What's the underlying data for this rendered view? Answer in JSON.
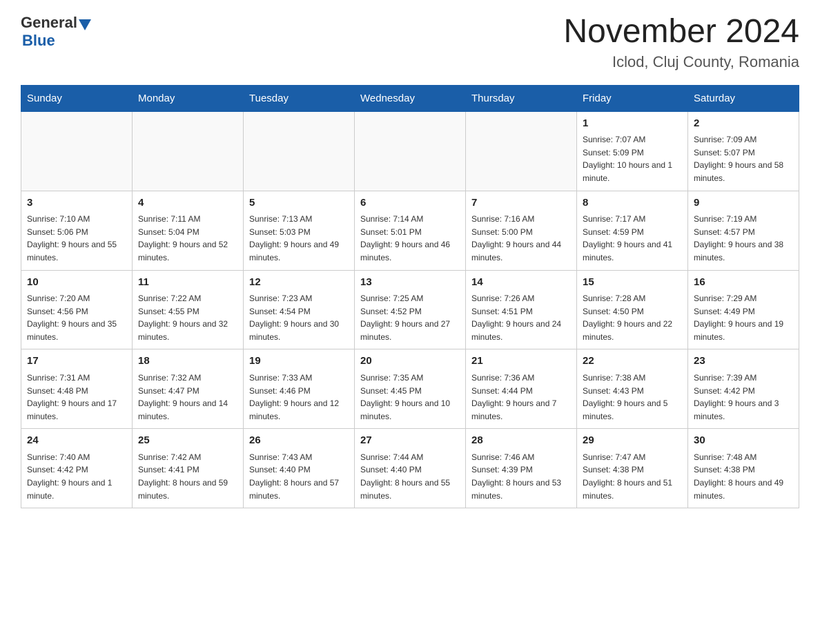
{
  "header": {
    "logo_general": "General",
    "logo_blue": "Blue",
    "month_title": "November 2024",
    "location": "Iclod, Cluj County, Romania"
  },
  "days_of_week": [
    "Sunday",
    "Monday",
    "Tuesday",
    "Wednesday",
    "Thursday",
    "Friday",
    "Saturday"
  ],
  "weeks": [
    {
      "days": [
        {
          "number": "",
          "info": ""
        },
        {
          "number": "",
          "info": ""
        },
        {
          "number": "",
          "info": ""
        },
        {
          "number": "",
          "info": ""
        },
        {
          "number": "",
          "info": ""
        },
        {
          "number": "1",
          "info": "Sunrise: 7:07 AM\nSunset: 5:09 PM\nDaylight: 10 hours and 1 minute."
        },
        {
          "number": "2",
          "info": "Sunrise: 7:09 AM\nSunset: 5:07 PM\nDaylight: 9 hours and 58 minutes."
        }
      ]
    },
    {
      "days": [
        {
          "number": "3",
          "info": "Sunrise: 7:10 AM\nSunset: 5:06 PM\nDaylight: 9 hours and 55 minutes."
        },
        {
          "number": "4",
          "info": "Sunrise: 7:11 AM\nSunset: 5:04 PM\nDaylight: 9 hours and 52 minutes."
        },
        {
          "number": "5",
          "info": "Sunrise: 7:13 AM\nSunset: 5:03 PM\nDaylight: 9 hours and 49 minutes."
        },
        {
          "number": "6",
          "info": "Sunrise: 7:14 AM\nSunset: 5:01 PM\nDaylight: 9 hours and 46 minutes."
        },
        {
          "number": "7",
          "info": "Sunrise: 7:16 AM\nSunset: 5:00 PM\nDaylight: 9 hours and 44 minutes."
        },
        {
          "number": "8",
          "info": "Sunrise: 7:17 AM\nSunset: 4:59 PM\nDaylight: 9 hours and 41 minutes."
        },
        {
          "number": "9",
          "info": "Sunrise: 7:19 AM\nSunset: 4:57 PM\nDaylight: 9 hours and 38 minutes."
        }
      ]
    },
    {
      "days": [
        {
          "number": "10",
          "info": "Sunrise: 7:20 AM\nSunset: 4:56 PM\nDaylight: 9 hours and 35 minutes."
        },
        {
          "number": "11",
          "info": "Sunrise: 7:22 AM\nSunset: 4:55 PM\nDaylight: 9 hours and 32 minutes."
        },
        {
          "number": "12",
          "info": "Sunrise: 7:23 AM\nSunset: 4:54 PM\nDaylight: 9 hours and 30 minutes."
        },
        {
          "number": "13",
          "info": "Sunrise: 7:25 AM\nSunset: 4:52 PM\nDaylight: 9 hours and 27 minutes."
        },
        {
          "number": "14",
          "info": "Sunrise: 7:26 AM\nSunset: 4:51 PM\nDaylight: 9 hours and 24 minutes."
        },
        {
          "number": "15",
          "info": "Sunrise: 7:28 AM\nSunset: 4:50 PM\nDaylight: 9 hours and 22 minutes."
        },
        {
          "number": "16",
          "info": "Sunrise: 7:29 AM\nSunset: 4:49 PM\nDaylight: 9 hours and 19 minutes."
        }
      ]
    },
    {
      "days": [
        {
          "number": "17",
          "info": "Sunrise: 7:31 AM\nSunset: 4:48 PM\nDaylight: 9 hours and 17 minutes."
        },
        {
          "number": "18",
          "info": "Sunrise: 7:32 AM\nSunset: 4:47 PM\nDaylight: 9 hours and 14 minutes."
        },
        {
          "number": "19",
          "info": "Sunrise: 7:33 AM\nSunset: 4:46 PM\nDaylight: 9 hours and 12 minutes."
        },
        {
          "number": "20",
          "info": "Sunrise: 7:35 AM\nSunset: 4:45 PM\nDaylight: 9 hours and 10 minutes."
        },
        {
          "number": "21",
          "info": "Sunrise: 7:36 AM\nSunset: 4:44 PM\nDaylight: 9 hours and 7 minutes."
        },
        {
          "number": "22",
          "info": "Sunrise: 7:38 AM\nSunset: 4:43 PM\nDaylight: 9 hours and 5 minutes."
        },
        {
          "number": "23",
          "info": "Sunrise: 7:39 AM\nSunset: 4:42 PM\nDaylight: 9 hours and 3 minutes."
        }
      ]
    },
    {
      "days": [
        {
          "number": "24",
          "info": "Sunrise: 7:40 AM\nSunset: 4:42 PM\nDaylight: 9 hours and 1 minute."
        },
        {
          "number": "25",
          "info": "Sunrise: 7:42 AM\nSunset: 4:41 PM\nDaylight: 8 hours and 59 minutes."
        },
        {
          "number": "26",
          "info": "Sunrise: 7:43 AM\nSunset: 4:40 PM\nDaylight: 8 hours and 57 minutes."
        },
        {
          "number": "27",
          "info": "Sunrise: 7:44 AM\nSunset: 4:40 PM\nDaylight: 8 hours and 55 minutes."
        },
        {
          "number": "28",
          "info": "Sunrise: 7:46 AM\nSunset: 4:39 PM\nDaylight: 8 hours and 53 minutes."
        },
        {
          "number": "29",
          "info": "Sunrise: 7:47 AM\nSunset: 4:38 PM\nDaylight: 8 hours and 51 minutes."
        },
        {
          "number": "30",
          "info": "Sunrise: 7:48 AM\nSunset: 4:38 PM\nDaylight: 8 hours and 49 minutes."
        }
      ]
    }
  ]
}
